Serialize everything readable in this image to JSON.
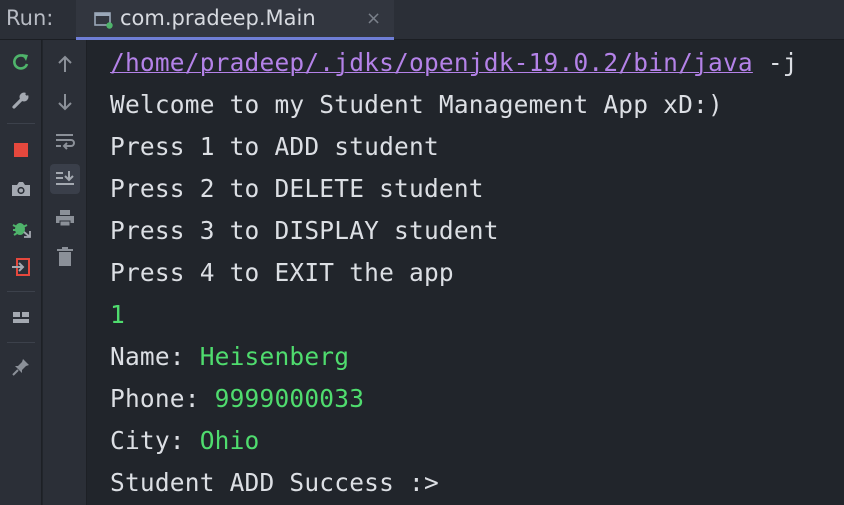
{
  "run_bar": {
    "label": "Run:",
    "tab_title": "com.pradeep.Main",
    "tab_close": "×"
  },
  "toolbar_left": [
    {
      "name": "rerun-icon"
    },
    {
      "name": "wrench-icon"
    },
    {
      "name": "stop-icon"
    },
    {
      "name": "camera-icon"
    },
    {
      "name": "debug-icon"
    },
    {
      "name": "exit-icon"
    },
    {
      "name": "layout-icon"
    },
    {
      "name": "pin-icon"
    }
  ],
  "toolbar_right": [
    {
      "name": "arrow-up-icon"
    },
    {
      "name": "arrow-down-icon"
    },
    {
      "name": "soft-wrap-icon"
    },
    {
      "name": "scroll-to-end-icon"
    },
    {
      "name": "print-icon"
    },
    {
      "name": "trash-icon"
    }
  ],
  "console": {
    "java_path": "/home/pradeep/.jdks/openjdk-19.0.2/bin/java",
    "java_args": " -j",
    "welcome": "Welcome to my Student Management App xD:)",
    "menu1": "Press 1 to ADD student",
    "menu2": "Press 2 to DELETE student",
    "menu3": "Press 3 to DISPLAY student",
    "menu4": "Press 4 to EXIT the app",
    "choice": "1",
    "name_label": "Name: ",
    "name_value": "Heisenberg",
    "phone_label": "Phone: ",
    "phone_value": "9999000033",
    "city_label": "City: ",
    "city_value": "Ohio",
    "result": "Student ADD Success :>"
  },
  "colors": {
    "path_link": "#b482e8",
    "user_input": "#4fdc6e",
    "stdout": "#dcdfe4",
    "tab_underline": "#6f7ed6"
  }
}
